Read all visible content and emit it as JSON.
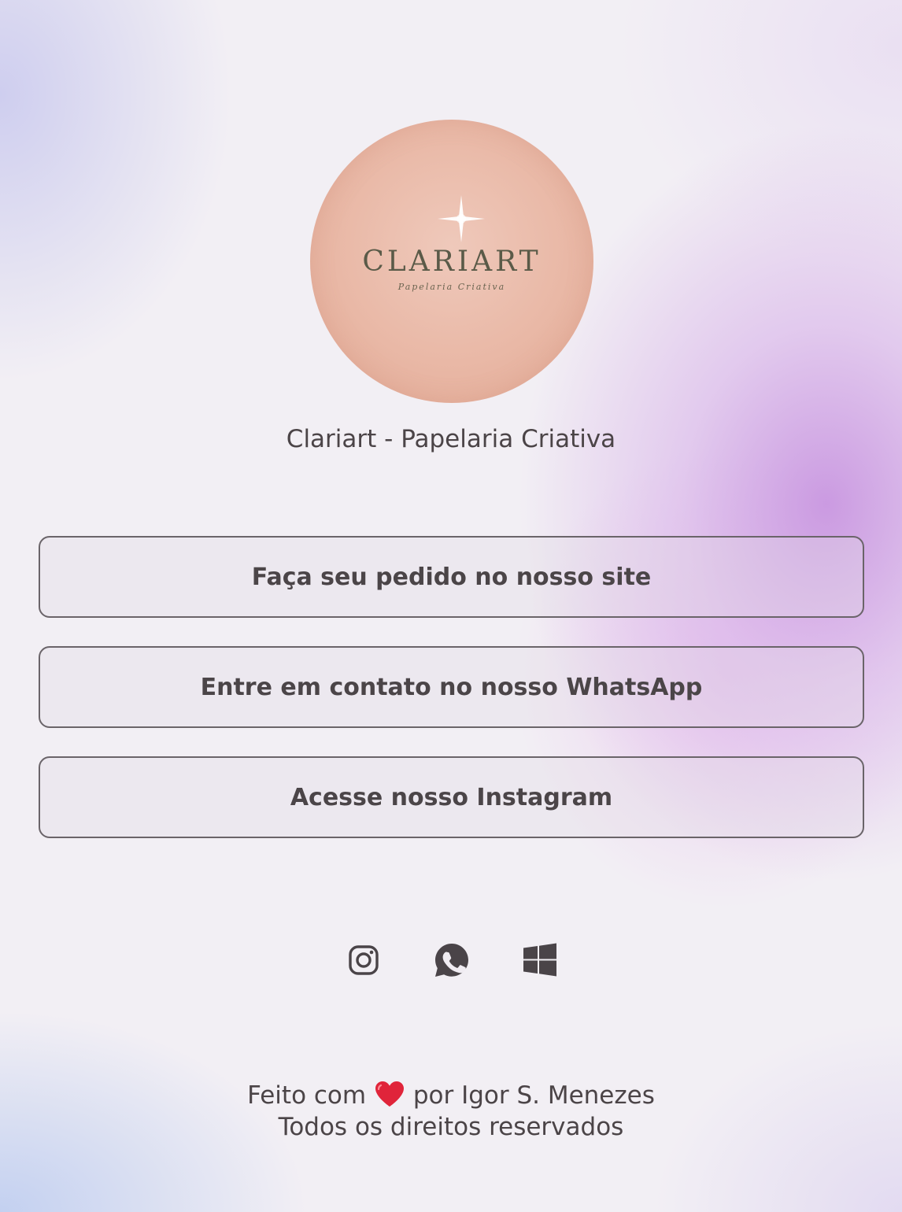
{
  "profile": {
    "logo_brand": "CLARIART",
    "logo_tagline": "Papelaria Criativa",
    "name": "Clariart - Papelaria Criativa"
  },
  "links": [
    {
      "label": "Faça seu pedido no nosso site"
    },
    {
      "label": "Entre em contato no nosso WhatsApp"
    },
    {
      "label": "Acesse nosso Instagram"
    }
  ],
  "social": [
    {
      "icon": "instagram-icon"
    },
    {
      "icon": "whatsapp-icon"
    },
    {
      "icon": "windows-icon"
    }
  ],
  "footer": {
    "made_with_prefix": "Feito com",
    "heart_icon": "heart-icon",
    "made_with_suffix": "por Igor S. Menezes",
    "rights": "Todos os direitos reservados"
  },
  "colors": {
    "text": "#4b4447",
    "button_border": "#6a6469",
    "avatar": "#e9b8a6",
    "logo_text": "#5a5a48",
    "heart": "#e0243a"
  }
}
